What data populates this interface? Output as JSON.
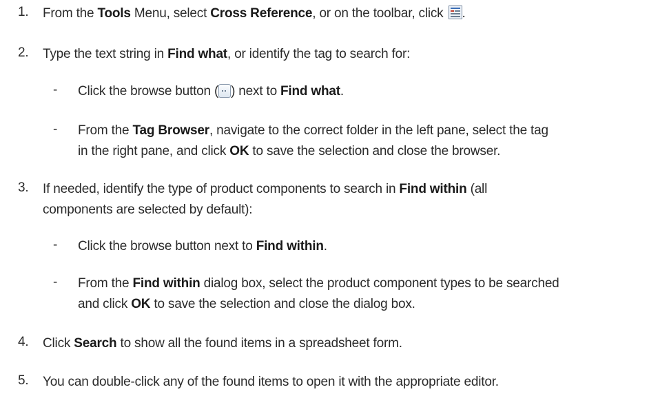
{
  "steps": [
    {
      "number": "1.",
      "parts": {
        "a": "From the ",
        "b": "Tools",
        "c": " Menu, select ",
        "d": "Cross Reference",
        "e": ", or on the toolbar, click ",
        "f": "."
      }
    },
    {
      "number": "2.",
      "parts": {
        "a": "Type the text string in ",
        "b": "Find what",
        "c": ", or identify the tag to search for:"
      },
      "subs": [
        {
          "dash": "-",
          "parts": {
            "a": "Click the browse button (",
            "b": ") next to ",
            "c": "Find what",
            "d": "."
          }
        },
        {
          "dash": "-",
          "line1": {
            "a": "From the ",
            "b": "Tag Browser",
            "c": ", navigate to the correct folder in the left pane, select the tag"
          },
          "line2": {
            "a": "in the right pane, and click ",
            "b": "OK",
            "c": " to save the selection and close the browser."
          }
        }
      ]
    },
    {
      "number": "3.",
      "line1": {
        "a": "If needed, identify the type of product components to search in ",
        "b": "Find within",
        "c": " (all"
      },
      "line2": "components are selected by default):",
      "subs": [
        {
          "dash": "-",
          "parts": {
            "a": "Click the browse button next to ",
            "b": "Find within",
            "c": "."
          }
        },
        {
          "dash": "-",
          "line1": {
            "a": "From the ",
            "b": "Find within",
            "c": " dialog box, select the product component types to be searched"
          },
          "line2": {
            "a": "and click ",
            "b": "OK",
            "c": " to save the selection and close the dialog box."
          }
        }
      ]
    },
    {
      "number": "4.",
      "parts": {
        "a": "Click ",
        "b": "Search",
        "c": " to show all the found items in a spreadsheet form."
      }
    },
    {
      "number": "5.",
      "text": "You can double-click any of the found items to open it with the appropriate editor."
    }
  ],
  "icons": {
    "toolbar_icon": "cross-reference-icon",
    "browse_icon": "browse-button-icon"
  }
}
